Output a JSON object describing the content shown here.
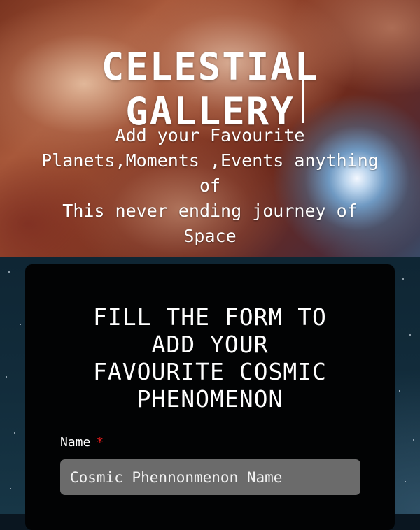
{
  "hero": {
    "title_lines": [
      "CELESTIAL",
      "GALLERY"
    ],
    "subtitle_lines": [
      "Add your Favourite",
      "Planets,Moments ,Events anything",
      "of",
      "This never ending journey of",
      "Space"
    ]
  },
  "form": {
    "heading_lines": [
      "FILL THE FORM TO",
      "ADD YOUR",
      "FAVOURITE COSMIC",
      "PHENOMENON"
    ],
    "name_label": "Name",
    "required_marker": "*",
    "name_placeholder": "Cosmic Phennonmenon Name"
  },
  "colors": {
    "card_background": "#020304",
    "input_background": "#6b6b6b",
    "required_marker": "#e01b1b",
    "text": "#ffffff"
  }
}
